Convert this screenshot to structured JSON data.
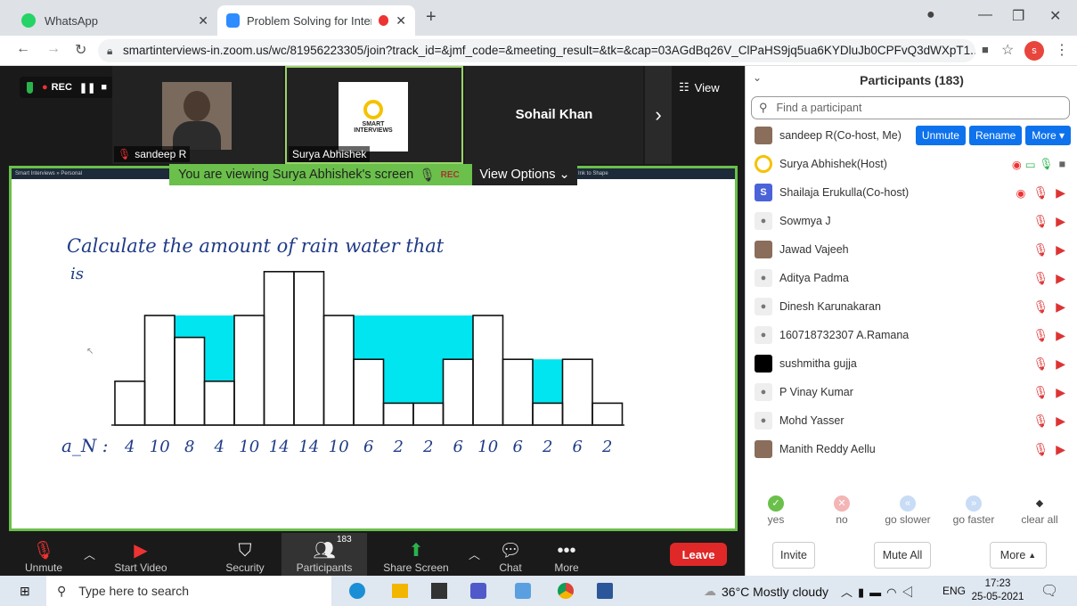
{
  "browser": {
    "tabs": [
      {
        "label": "WhatsApp",
        "icon": "whatsapp-icon"
      },
      {
        "label": "Problem Solving for Intervie",
        "icon": "zoom-icon"
      }
    ],
    "url": "smartinterviews-in.zoom.us/wc/81956223305/join?track_id=&jmf_code=&meeting_result=&tk=&cap=03AGdBq26V_ClPaHS9jq5ua6KYDluJb0CPFvQ3dWXpT1...",
    "profile_initial": "s"
  },
  "meeting": {
    "rec_label": "REC",
    "view_label": "View",
    "tiles": [
      {
        "name": "sandeep R"
      },
      {
        "name": "Surya Abhishek",
        "logo_text": "SMART INTERVIEWS"
      },
      {
        "name": "Sohail Khan"
      }
    ],
    "share_banner": "You are viewing Surya Abhishek's screen",
    "share_rec": "REC",
    "view_options": "View Options",
    "whiteboard": {
      "tab_label": "Smart Interviews » Personal",
      "toolbar_hint": "Ink to Shape",
      "line1": "Calculate the amount of rain water that",
      "line2": "is",
      "array_label": "a_N :",
      "values": [
        4,
        10,
        8,
        4,
        10,
        14,
        14,
        10,
        6,
        2,
        2,
        6,
        10,
        6,
        2,
        6,
        2
      ],
      "value_labels": [
        "4",
        "10",
        "8",
        "4",
        "10",
        "14",
        "14",
        "10",
        "6",
        "2",
        "2",
        "6",
        "10",
        "6",
        "2",
        "6",
        "2"
      ]
    }
  },
  "controls": [
    {
      "label": "Unmute",
      "icon": "mic-off-icon"
    },
    {
      "label": "Start Video",
      "icon": "video-off-icon"
    },
    {
      "label": "Security",
      "icon": "shield-icon"
    },
    {
      "label": "Participants",
      "icon": "participants-icon",
      "badge": "183"
    },
    {
      "label": "Share Screen",
      "icon": "share-screen-icon"
    },
    {
      "label": "Chat",
      "icon": "chat-icon"
    },
    {
      "label": "More",
      "icon": "more-icon"
    }
  ],
  "leave_label": "Leave",
  "participants": {
    "title": "Participants (183)",
    "search_placeholder": "Find a participant",
    "unmute_label": "Unmute",
    "rename_label": "Rename",
    "more_label": "More",
    "list": [
      {
        "name": "sandeep R(Co-host, Me)",
        "avatar": "photo"
      },
      {
        "name": "Surya Abhishek(Host)",
        "avatar": "logo"
      },
      {
        "name": "Shailaja Erukulla(Co-host)",
        "avatar": "S"
      },
      {
        "name": "Sowmya J",
        "avatar": "default"
      },
      {
        "name": "Jawad Vajeeh",
        "avatar": "photo"
      },
      {
        "name": "Aditya Padma",
        "avatar": "default"
      },
      {
        "name": "Dinesh Karunakaran",
        "avatar": "default"
      },
      {
        "name": "160718732307 A.Ramana",
        "avatar": "default"
      },
      {
        "name": "sushmitha gujja",
        "avatar": "black"
      },
      {
        "name": "P Vinay Kumar",
        "avatar": "default"
      },
      {
        "name": "Mohd Yasser",
        "avatar": "default"
      },
      {
        "name": "Manith Reddy Aellu",
        "avatar": "photo"
      }
    ],
    "reactions": [
      {
        "label": "yes",
        "color": "#6ac04a",
        "glyph": "✓"
      },
      {
        "label": "no",
        "color": "#f3b5b5",
        "glyph": "✕"
      },
      {
        "label": "go slower",
        "color": "#c8dcf5",
        "glyph": "«"
      },
      {
        "label": "go faster",
        "color": "#c8dcf5",
        "glyph": "»"
      },
      {
        "label": "clear all",
        "color": "transparent",
        "glyph": "◆"
      }
    ],
    "invite_label": "Invite",
    "mute_all_label": "Mute All",
    "footer_more_label": "More"
  },
  "taskbar": {
    "search_placeholder": "Type here to search",
    "weather": "36°C  Mostly cloudy",
    "lang": "ENG",
    "time": "17:23",
    "date": "25-05-2021"
  },
  "colors": {
    "accent": "#0e72ed",
    "water": "#00e5f0",
    "share_border": "#6ac04a",
    "leave": "#e02828"
  }
}
